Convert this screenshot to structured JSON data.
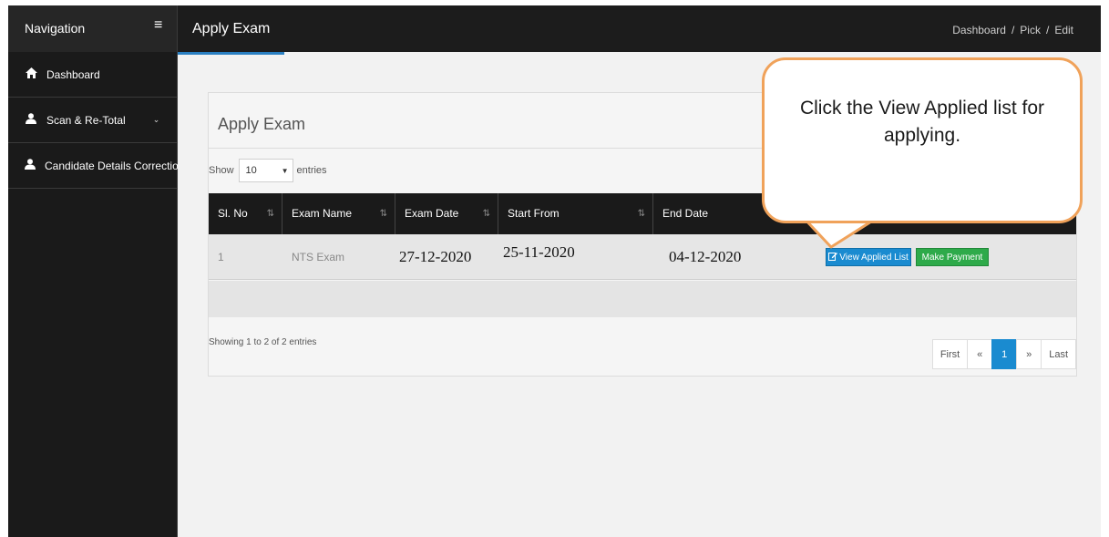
{
  "nav": {
    "title": "Navigation",
    "menu_icon": "hamburger-icon"
  },
  "header": {
    "title": "Apply Exam",
    "breadcrumb": [
      "Dashboard",
      "Pick",
      "Edit"
    ],
    "separator": "/"
  },
  "sidebar": {
    "items": [
      {
        "label": "Dashboard",
        "icon": "home-icon"
      },
      {
        "label": "Scan & Re-Total",
        "icon": "user-icon",
        "has_chevron": true
      },
      {
        "label": "Candidate Details Correction Li",
        "icon": "user-icon"
      }
    ]
  },
  "panel": {
    "title": "Apply Exam",
    "show_label": "Show",
    "page_size": "10",
    "entries_label": "entries",
    "columns": [
      "Sl. No",
      "Exam Name",
      "Exam Date",
      "Start From",
      "End Date"
    ],
    "rows": [
      {
        "sl_no": "1",
        "exam_name": "NTS Exam",
        "exam_date": "27-12-2020",
        "start_from": "25-11-2020",
        "end_date": "04-12-2020",
        "view_label": "View Applied List",
        "pay_label": "Make Payment"
      }
    ],
    "showing_text": "Showing 1 to 2 of 2 entries",
    "pagination": {
      "first": "First",
      "prev": "«",
      "current": "1",
      "next": "»",
      "last": "Last"
    }
  },
  "callout": {
    "text": "Click the View Applied list for applying."
  },
  "colors": {
    "accent": "#1a8bd0",
    "success": "#2eaa4a",
    "callout_border": "#f0a25a",
    "dark": "#1a1a1a"
  }
}
